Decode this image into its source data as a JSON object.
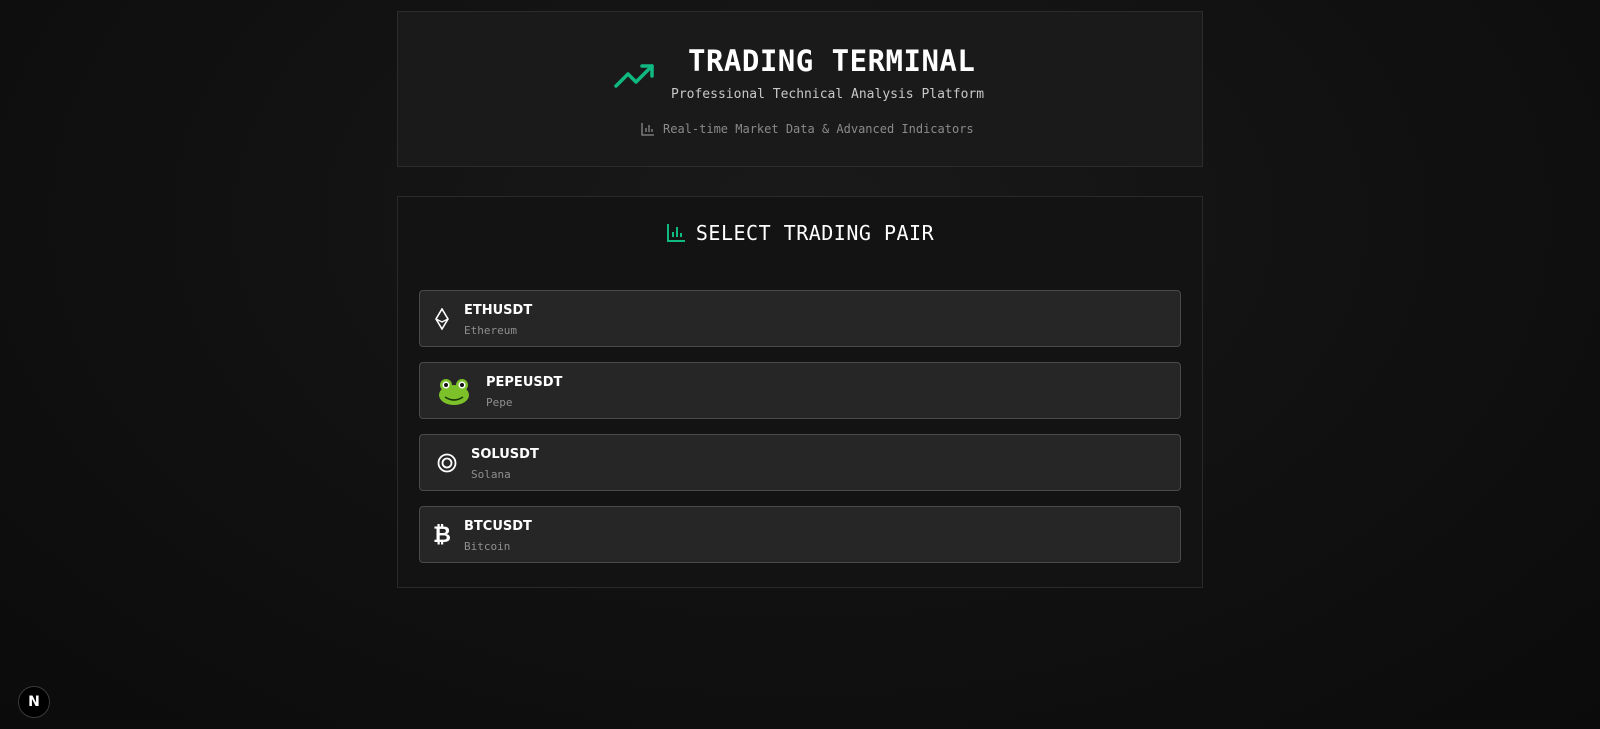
{
  "header": {
    "title": "TRADING TERMINAL",
    "subtitle": "Professional Technical Analysis Platform",
    "tagline": "Real-time Market Data & Advanced Indicators"
  },
  "pairs_section": {
    "title": "SELECT TRADING PAIR",
    "items": [
      {
        "symbol": "ETHUSDT",
        "name": "Ethereum",
        "icon": "ethereum-icon",
        "glyph": "⟠"
      },
      {
        "symbol": "PEPEUSDT",
        "name": "Pepe",
        "icon": "frog-icon",
        "glyph": "🐸"
      },
      {
        "symbol": "SOLUSDT",
        "name": "Solana",
        "icon": "solana-ring-icon",
        "glyph": "◎"
      },
      {
        "symbol": "BTCUSDT",
        "name": "Bitcoin",
        "icon": "bitcoin-icon",
        "glyph": "₿"
      }
    ]
  },
  "badge": {
    "label": "N"
  },
  "colors": {
    "accent": "#10b981",
    "background": "#0f0f0f",
    "card": "#1a1a1a",
    "pair_bg": "#262626"
  }
}
